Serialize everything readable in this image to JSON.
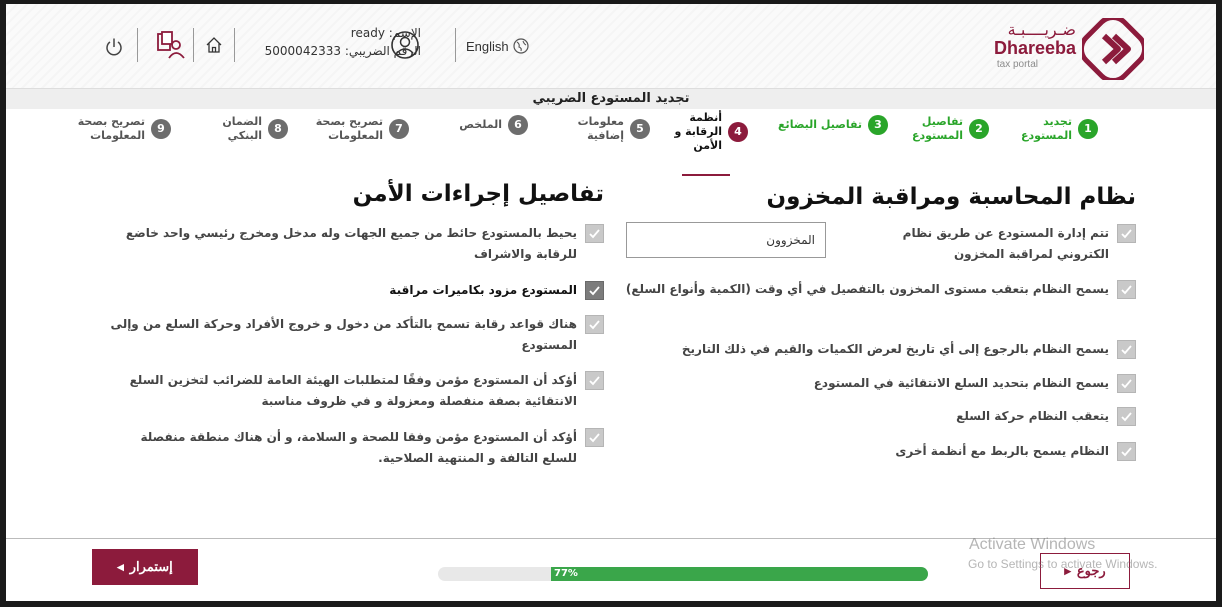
{
  "header": {
    "logo_ar": "ضـريــــبـة",
    "logo_en": "Dhareeba",
    "logo_sub": "tax portal",
    "language": "English",
    "user_name": "الإسم: ready",
    "user_tax": "الرقم الضريبي: 5000042333"
  },
  "page_title": "تجديد المستودع الضريبي",
  "steps": [
    {
      "num": "1",
      "label": "تجديد المستودع",
      "state": "done"
    },
    {
      "num": "2",
      "label": "تفاصيل المستودع",
      "state": "done"
    },
    {
      "num": "3",
      "label": "تفاصيل البضائع",
      "state": "done"
    },
    {
      "num": "4",
      "label": "أنظمة الرقابة و الأمن",
      "state": "active"
    },
    {
      "num": "5",
      "label": "معلومات إضافية",
      "state": "todo"
    },
    {
      "num": "6",
      "label": "الملخص",
      "state": "todo"
    },
    {
      "num": "7",
      "label": "تصريح بصحة المعلومات",
      "state": "todo"
    },
    {
      "num": "8",
      "label": "الضمان البنكي",
      "state": "todo"
    },
    {
      "num": "9",
      "label": "تصريح بصحة المعلومات",
      "state": "todo"
    }
  ],
  "inventory": {
    "title": "نظام المحاسبة ومراقبة المخزون",
    "field_value": "المخزوون",
    "items": [
      {
        "text": "تتم إدارة المستودع عن طريق نظام الكتروني لمراقبة المخزون",
        "checked": false
      },
      {
        "text": "يسمح النظام بتعقب مستوى المخزون بالتفصيل في أي وقت (الكمية وأنواع السلع)",
        "checked": false
      },
      {
        "text": "يسمح النظام بالرجوع إلى أي تاريخ لعرض الكميات والقيم في ذلك التاريخ",
        "checked": false
      },
      {
        "text": "يسمح النظام بتحديد السلع الانتقائية في المستودع",
        "checked": false
      },
      {
        "text": "يتعقب النظام حركة السلع",
        "checked": false
      },
      {
        "text": "النظام يسمح بالربط مع أنظمة أخرى",
        "checked": false
      }
    ]
  },
  "security": {
    "title": "تفاصيل إجراءات الأمن",
    "items": [
      {
        "text": "يحيط بالمستودع حائط من جميع الجهات وله مدخل ومخرج رئيسي واحد خاضع للرقابة والاشراف",
        "checked": false
      },
      {
        "text": "المستودع مزود بكاميرات مراقبة",
        "checked": true
      },
      {
        "text": "هناك قواعد رقابة تسمح بالتأكد من دخول و خروج الأفراد وحركة السلع من وإلى المستودع",
        "checked": false
      },
      {
        "text": "أؤكد أن المستودع مؤمن وفقًا لمتطلبات الهيئة العامة للضرائب لتخزين السلع الانتقائية بصفة منفصلة ومعزولة و في ظروف مناسبة",
        "checked": false
      },
      {
        "text": "أؤكد أن المستودع مؤمن وفقا للصحة و السلامة، و أن هناك منطقة منفصلة للسلع التالفة و المنتهية الصلاحية.",
        "checked": false
      }
    ]
  },
  "footer": {
    "continue_label": "إستمرار",
    "back_label": "رجوع",
    "progress": 77,
    "progress_text": "77%"
  },
  "watermark": {
    "line1": "Activate Windows",
    "line2": "Go to Settings to activate Windows."
  },
  "colors": {
    "brand": "#8c1b3c",
    "done": "#2aa52a",
    "progress": "#3aa64a"
  }
}
